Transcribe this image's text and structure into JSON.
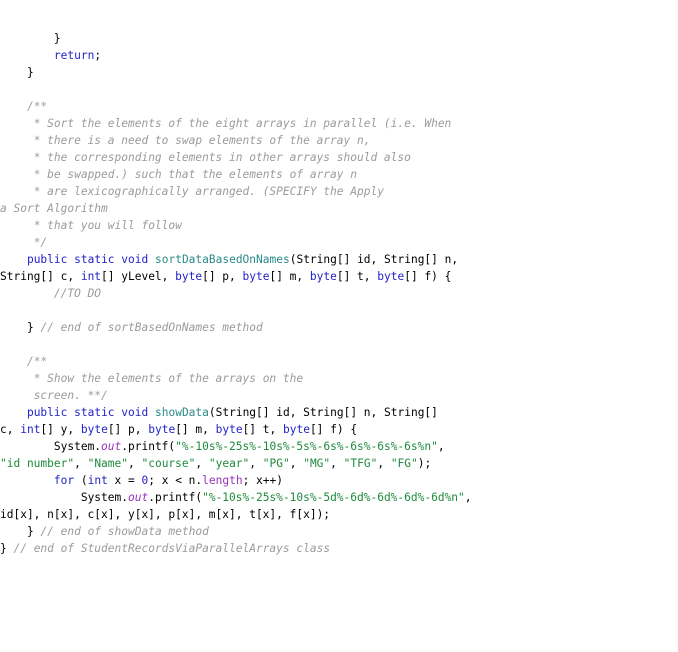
{
  "editor": {
    "name": "java-source-view",
    "language": "Java",
    "font_size_px": 11.2,
    "line_height_px": 17,
    "background": "#ffffff",
    "colors": {
      "plain": "#000000",
      "keyword": "#2222cc",
      "type": "#2222cc",
      "method": "#2b8a8a",
      "string": "#1f8a3d",
      "field": "#9933bb",
      "property": "#9933bb",
      "number": "#2222cc",
      "comment": "#9b9b9b"
    }
  },
  "code": {
    "lines": [
      {
        "id": "line-1",
        "indent": 8,
        "tokens": [
          {
            "t": "}",
            "c": "pln"
          }
        ]
      },
      {
        "id": "line-2",
        "indent": 8,
        "tokens": [
          {
            "t": "return",
            "c": "kw"
          },
          {
            "t": ";",
            "c": "pln"
          }
        ]
      },
      {
        "id": "line-3",
        "indent": 4,
        "tokens": [
          {
            "t": "}",
            "c": "pln"
          }
        ]
      },
      {
        "id": "line-4",
        "indent": 0,
        "tokens": [
          {
            "t": "",
            "c": "pln"
          }
        ]
      },
      {
        "id": "line-5",
        "indent": 4,
        "tokens": [
          {
            "t": "/**",
            "c": "cmt"
          }
        ]
      },
      {
        "id": "line-6",
        "indent": 5,
        "tokens": [
          {
            "t": "* Sort the elements of the eight arrays in parallel (i.e. When",
            "c": "cmt"
          }
        ]
      },
      {
        "id": "line-7",
        "indent": 5,
        "tokens": [
          {
            "t": "* there is a need to swap elements of the array n,",
            "c": "cmt"
          }
        ]
      },
      {
        "id": "line-8",
        "indent": 5,
        "tokens": [
          {
            "t": "* the corresponding elements in other arrays should also",
            "c": "cmt"
          }
        ]
      },
      {
        "id": "line-9",
        "indent": 5,
        "tokens": [
          {
            "t": "* be swapped.) such that the elements of array n",
            "c": "cmt"
          }
        ]
      },
      {
        "id": "line-10",
        "indent": 5,
        "tokens": [
          {
            "t": "* are lexicographically arranged. (SPECIFY the Apply",
            "c": "cmt"
          }
        ]
      },
      {
        "id": "line-11",
        "indent": 0,
        "tokens": [
          {
            "t": "a Sort Algorithm",
            "c": "cmt"
          }
        ]
      },
      {
        "id": "line-12",
        "indent": 5,
        "tokens": [
          {
            "t": "* that you will follow",
            "c": "cmt"
          }
        ]
      },
      {
        "id": "line-13",
        "indent": 5,
        "tokens": [
          {
            "t": "*/",
            "c": "cmt"
          }
        ]
      },
      {
        "id": "line-14",
        "indent": 4,
        "tokens": [
          {
            "t": "public",
            "c": "kw"
          },
          {
            "t": " ",
            "c": "pln"
          },
          {
            "t": "static",
            "c": "kw"
          },
          {
            "t": " ",
            "c": "pln"
          },
          {
            "t": "void",
            "c": "kw"
          },
          {
            "t": " ",
            "c": "pln"
          },
          {
            "t": "sortDataBasedOnNames",
            "c": "mth"
          },
          {
            "t": "(String[] id, String[] n,",
            "c": "pln"
          }
        ]
      },
      {
        "id": "line-15",
        "indent": 0,
        "tokens": [
          {
            "t": "String[] c, ",
            "c": "pln"
          },
          {
            "t": "int",
            "c": "ty"
          },
          {
            "t": "[] yLevel, ",
            "c": "pln"
          },
          {
            "t": "byte",
            "c": "ty"
          },
          {
            "t": "[] p, ",
            "c": "pln"
          },
          {
            "t": "byte",
            "c": "ty"
          },
          {
            "t": "[] m, ",
            "c": "pln"
          },
          {
            "t": "byte",
            "c": "ty"
          },
          {
            "t": "[] t, ",
            "c": "pln"
          },
          {
            "t": "byte",
            "c": "ty"
          },
          {
            "t": "[] f) {",
            "c": "pln"
          }
        ]
      },
      {
        "id": "line-16",
        "indent": 8,
        "tokens": [
          {
            "t": "//TO DO",
            "c": "cmt"
          }
        ]
      },
      {
        "id": "line-17",
        "indent": 0,
        "tokens": [
          {
            "t": "",
            "c": "pln"
          }
        ]
      },
      {
        "id": "line-18",
        "indent": 4,
        "tokens": [
          {
            "t": "} ",
            "c": "pln"
          },
          {
            "t": "// end of sortBasedOnNames method",
            "c": "cmt"
          }
        ]
      },
      {
        "id": "line-19",
        "indent": 0,
        "tokens": [
          {
            "t": "",
            "c": "pln"
          }
        ]
      },
      {
        "id": "line-20",
        "indent": 4,
        "tokens": [
          {
            "t": "/**",
            "c": "cmt"
          }
        ]
      },
      {
        "id": "line-21",
        "indent": 5,
        "tokens": [
          {
            "t": "* Show the elements of the arrays on the",
            "c": "cmt"
          }
        ]
      },
      {
        "id": "line-22",
        "indent": 5,
        "tokens": [
          {
            "t": "screen. **/",
            "c": "cmt"
          }
        ]
      },
      {
        "id": "line-23",
        "indent": 4,
        "tokens": [
          {
            "t": "public",
            "c": "kw"
          },
          {
            "t": " ",
            "c": "pln"
          },
          {
            "t": "static",
            "c": "kw"
          },
          {
            "t": " ",
            "c": "pln"
          },
          {
            "t": "void",
            "c": "kw"
          },
          {
            "t": " ",
            "c": "pln"
          },
          {
            "t": "showData",
            "c": "mth"
          },
          {
            "t": "(String[] id, String[] n, String[]",
            "c": "pln"
          }
        ]
      },
      {
        "id": "line-24",
        "indent": 0,
        "tokens": [
          {
            "t": "c, ",
            "c": "pln"
          },
          {
            "t": "int",
            "c": "ty"
          },
          {
            "t": "[] y, ",
            "c": "pln"
          },
          {
            "t": "byte",
            "c": "ty"
          },
          {
            "t": "[] p, ",
            "c": "pln"
          },
          {
            "t": "byte",
            "c": "ty"
          },
          {
            "t": "[] m, ",
            "c": "pln"
          },
          {
            "t": "byte",
            "c": "ty"
          },
          {
            "t": "[] t, ",
            "c": "pln"
          },
          {
            "t": "byte",
            "c": "ty"
          },
          {
            "t": "[] f) {",
            "c": "pln"
          }
        ]
      },
      {
        "id": "line-25",
        "indent": 8,
        "tokens": [
          {
            "t": "System.",
            "c": "pln"
          },
          {
            "t": "out",
            "c": "fld"
          },
          {
            "t": ".printf(",
            "c": "pln"
          },
          {
            "t": "\"%-10s%-25s%-10s%-5s%-6s%-6s%-6s%-6s%n\"",
            "c": "str"
          },
          {
            "t": ",",
            "c": "pln"
          }
        ]
      },
      {
        "id": "line-26",
        "indent": 0,
        "tokens": [
          {
            "t": "\"id number\"",
            "c": "str"
          },
          {
            "t": ", ",
            "c": "pln"
          },
          {
            "t": "\"Name\"",
            "c": "str"
          },
          {
            "t": ", ",
            "c": "pln"
          },
          {
            "t": "\"course\"",
            "c": "str"
          },
          {
            "t": ", ",
            "c": "pln"
          },
          {
            "t": "\"year\"",
            "c": "str"
          },
          {
            "t": ", ",
            "c": "pln"
          },
          {
            "t": "\"PG\"",
            "c": "str"
          },
          {
            "t": ", ",
            "c": "pln"
          },
          {
            "t": "\"MG\"",
            "c": "str"
          },
          {
            "t": ", ",
            "c": "pln"
          },
          {
            "t": "\"TFG\"",
            "c": "str"
          },
          {
            "t": ", ",
            "c": "pln"
          },
          {
            "t": "\"FG\"",
            "c": "str"
          },
          {
            "t": ");",
            "c": "pln"
          }
        ]
      },
      {
        "id": "line-27",
        "indent": 8,
        "tokens": [
          {
            "t": "for",
            "c": "kw"
          },
          {
            "t": " (",
            "c": "pln"
          },
          {
            "t": "int",
            "c": "ty"
          },
          {
            "t": " x = ",
            "c": "pln"
          },
          {
            "t": "0",
            "c": "num"
          },
          {
            "t": "; x < n.",
            "c": "pln"
          },
          {
            "t": "length",
            "c": "prop"
          },
          {
            "t": "; x++)",
            "c": "pln"
          }
        ]
      },
      {
        "id": "line-28",
        "indent": 12,
        "tokens": [
          {
            "t": "System.",
            "c": "pln"
          },
          {
            "t": "out",
            "c": "fld"
          },
          {
            "t": ".printf(",
            "c": "pln"
          },
          {
            "t": "\"%-10s%-25s%-10s%-5d%-6d%-6d%-6d%-6d%n\"",
            "c": "str"
          },
          {
            "t": ",",
            "c": "pln"
          }
        ]
      },
      {
        "id": "line-29",
        "indent": 0,
        "tokens": [
          {
            "t": "id[x], n[x], c[x], y[x], p[x], m[x], t[x], f[x]);",
            "c": "pln"
          }
        ]
      },
      {
        "id": "line-30",
        "indent": 4,
        "tokens": [
          {
            "t": "} ",
            "c": "pln"
          },
          {
            "t": "// end of showData method",
            "c": "cmt"
          }
        ]
      },
      {
        "id": "line-31",
        "indent": 0,
        "tokens": [
          {
            "t": "} ",
            "c": "pln"
          },
          {
            "t": "// end of StudentRecordsViaParallelArrays class",
            "c": "cmt"
          }
        ]
      }
    ]
  }
}
